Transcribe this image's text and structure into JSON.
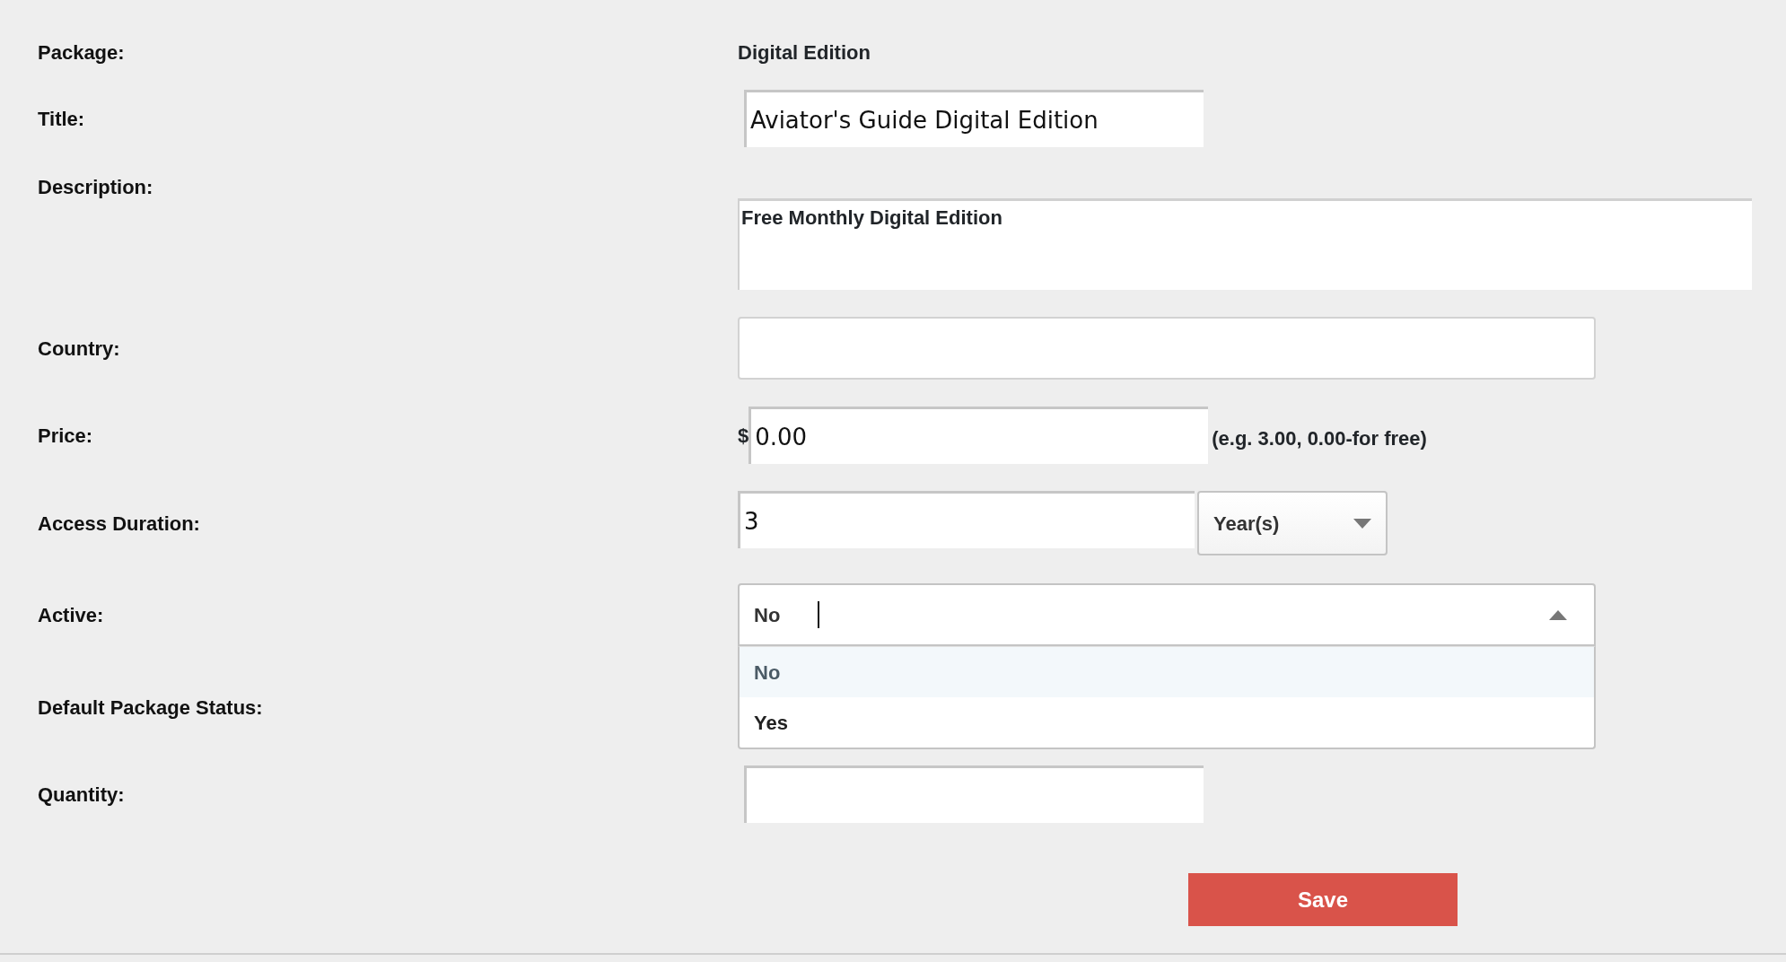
{
  "fields": [
    {
      "kind": "text",
      "label": "Package:",
      "value": "Digital Edition"
    },
    {
      "kind": "input",
      "label": "Title:",
      "value": "Aviator's Guide Digital Edition"
    },
    {
      "kind": "textarea",
      "label": "Description:",
      "value": "Free Monthly Digital Edition"
    },
    {
      "kind": "box",
      "label": "Country:"
    },
    {
      "kind": "price",
      "label": "Price:",
      "prefix": "$",
      "value": "0.00",
      "hint": "(e.g. 3.00, 0.00-for free)"
    },
    {
      "kind": "duration",
      "label": "Access Duration:",
      "value": "3",
      "unit": "Year(s)"
    },
    {
      "kind": "dropdown",
      "label": "Active:",
      "value": "No",
      "expanded": true,
      "options": [
        {
          "label": "No",
          "selected": true
        },
        {
          "label": "Yes",
          "selected": false
        }
      ]
    },
    {
      "kind": "covered",
      "label": "Default Package Status:"
    },
    {
      "kind": "input",
      "label": "Quantity:"
    }
  ],
  "save_button": "Save"
}
